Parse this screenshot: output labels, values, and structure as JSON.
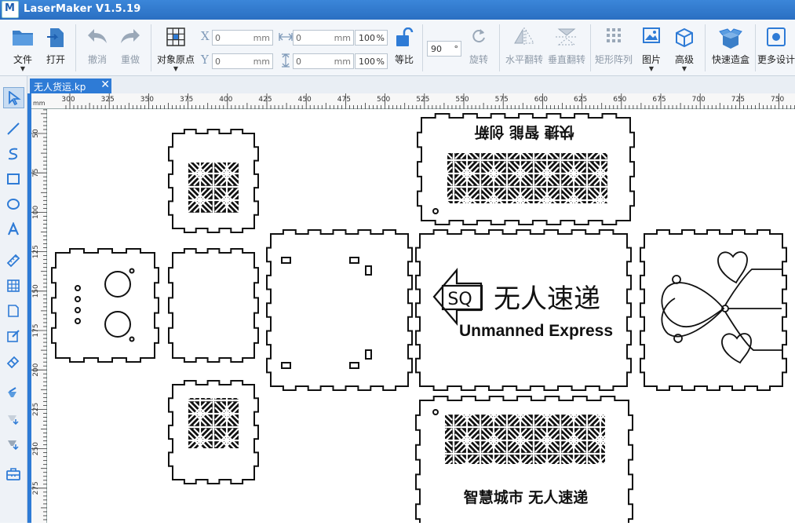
{
  "window": {
    "title": "LaserMaker V1.5.19",
    "logo_text": "M"
  },
  "toolbar": {
    "file": "文件",
    "open": "打开",
    "undo": "撤消",
    "redo": "重做",
    "origin": "对象原点",
    "x_label": "X",
    "y_label": "Y",
    "x_value": "0",
    "y_value": "0",
    "w_value": "0",
    "h_value": "0",
    "unit": "mm",
    "w_pct": "100",
    "h_pct": "100",
    "pct_unit": "%",
    "ratio": "等比",
    "angle_value": "90",
    "angle_unit": "°",
    "rotate": "旋转",
    "flip_h": "水平翻转",
    "flip_v": "垂直翻转",
    "array": "矩形阵列",
    "image": "图片",
    "advanced": "高级",
    "quick_box": "快速造盒",
    "more_design": "更多设计"
  },
  "tab": {
    "label": "无人货运.kp",
    "close": "✕"
  },
  "ruler": {
    "unit_label": "mm",
    "top_ticks": [
      "300",
      "325",
      "350",
      "375",
      "400",
      "425",
      "450",
      "475",
      "500",
      "525",
      "550",
      "575",
      "600",
      "625",
      "650",
      "675",
      "700",
      "725",
      "750"
    ],
    "left_ticks": [
      "50",
      "75",
      "100",
      "125",
      "150",
      "175",
      "200",
      "225",
      "250",
      "275"
    ]
  },
  "canvas": {
    "top_panel_text": "快捷 智能 创新",
    "logo_abbr": "SQ",
    "main_title": "无人速递",
    "main_subtitle": "Unmanned Express",
    "bottom_panel_text": "智慧城市 无人速递"
  },
  "colors": {
    "accent": "#2e7bd6",
    "titlebar": "#2a6fc2",
    "icon_blue": "#3b7fc8",
    "icon_gray": "#9aa8b8"
  }
}
